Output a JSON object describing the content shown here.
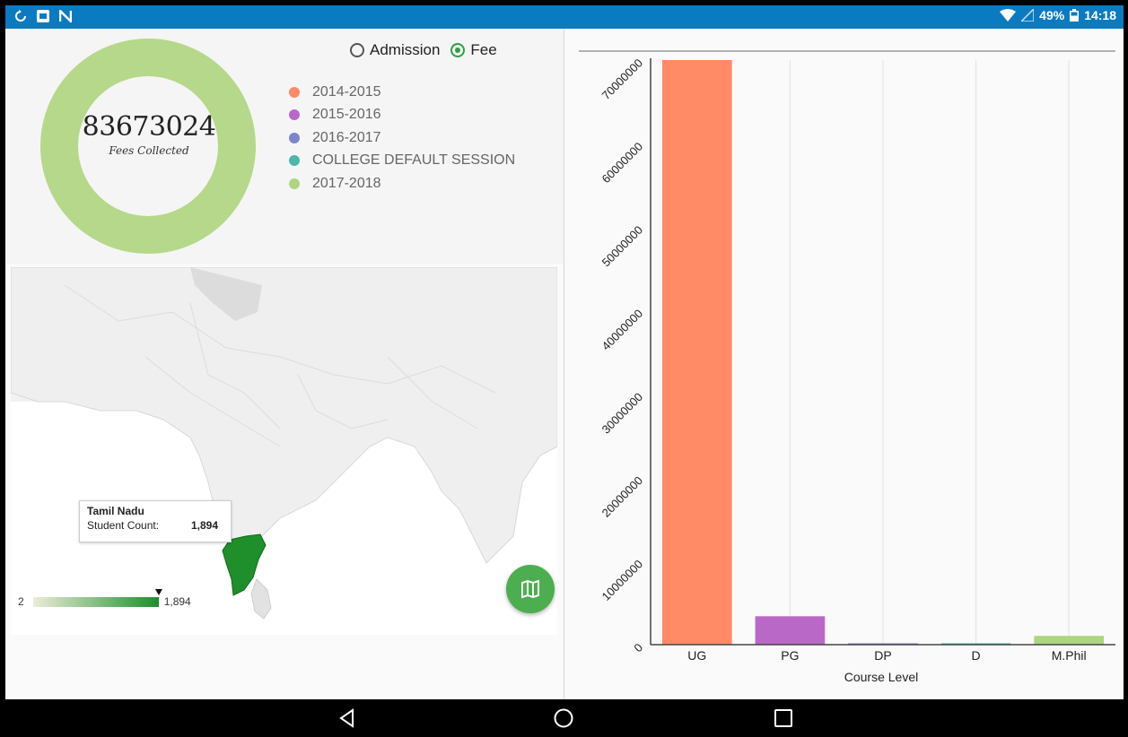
{
  "status_bar": {
    "battery": "49%",
    "time": "14:18",
    "left_icons": [
      "sync-icon",
      "app-icon",
      "n-icon"
    ],
    "right_icons": [
      "wifi-icon",
      "signal-icon",
      "battery-icon"
    ]
  },
  "toggle": {
    "options": [
      {
        "label": "Admission",
        "selected": false
      },
      {
        "label": "Fee",
        "selected": true
      }
    ]
  },
  "donut": {
    "value": "83673024",
    "caption": "Fees Collected",
    "color": "#b5d88a",
    "legend": [
      {
        "label": "2014-2015",
        "color": "#ff8a65"
      },
      {
        "label": "2015-2016",
        "color": "#ba68c8"
      },
      {
        "label": "2016-2017",
        "color": "#7986cb"
      },
      {
        "label": "COLLEGE DEFAULT SESSION",
        "color": "#4db6ac"
      },
      {
        "label": "2017-2018",
        "color": "#aed581"
      }
    ]
  },
  "map": {
    "tooltip_title": "Tamil Nadu",
    "tooltip_label": "Student Count:",
    "tooltip_value": "1,894",
    "scale_min": "2",
    "scale_max": "1,894",
    "fab_icon": "map-icon"
  },
  "chart_data": {
    "type": "bar",
    "categories": [
      "UG",
      "PG",
      "DP",
      "D",
      "M.Phil"
    ],
    "values": [
      70000000,
      3400000,
      50000,
      50000,
      1050000
    ],
    "colors": [
      "#ff8a65",
      "#ba68c8",
      "#7986cb",
      "#4db6ac",
      "#aed581"
    ],
    "xlabel": "Course Level",
    "ylim": [
      0,
      70000000
    ],
    "yticks": [
      0,
      10000000,
      20000000,
      30000000,
      40000000,
      50000000,
      60000000,
      70000000
    ],
    "grid": "vertical"
  },
  "nav_bar": {
    "icons": [
      "back-icon",
      "home-icon",
      "recents-icon"
    ]
  }
}
